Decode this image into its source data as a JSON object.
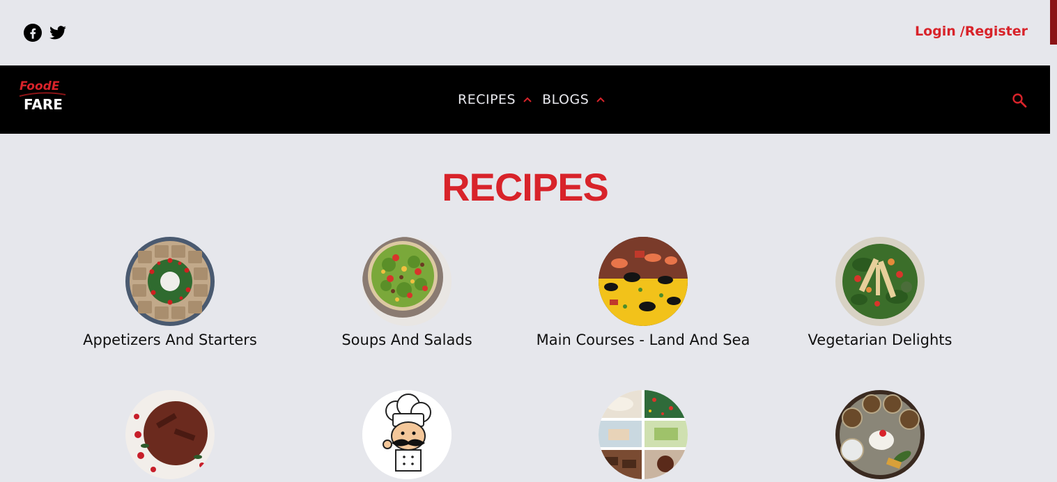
{
  "header": {
    "social": [
      {
        "icon": "facebook-icon"
      },
      {
        "icon": "twitter-icon"
      }
    ],
    "auth": {
      "login": "Login",
      "register": "/Register"
    }
  },
  "navbar": {
    "logo": {
      "line1": "FoodE",
      "line2": "FARE"
    },
    "menu": [
      {
        "label": "RECIPES",
        "icon": "chevron-up-icon"
      },
      {
        "label": "BLOGS",
        "icon": "chevron-up-icon"
      }
    ],
    "search_icon": "search-icon"
  },
  "main": {
    "heading": "RECIPES",
    "categories": [
      {
        "title": "Appetizers And Starters"
      },
      {
        "title": "Soups And Salads"
      },
      {
        "title": "Main Courses - Land And Sea"
      },
      {
        "title": "Vegetarian Delights"
      },
      {
        "title": ""
      },
      {
        "title": ""
      },
      {
        "title": ""
      },
      {
        "title": ""
      }
    ]
  },
  "colors": {
    "accent": "#d8232a",
    "navbar": "#000000",
    "background": "#e6e7ec"
  }
}
